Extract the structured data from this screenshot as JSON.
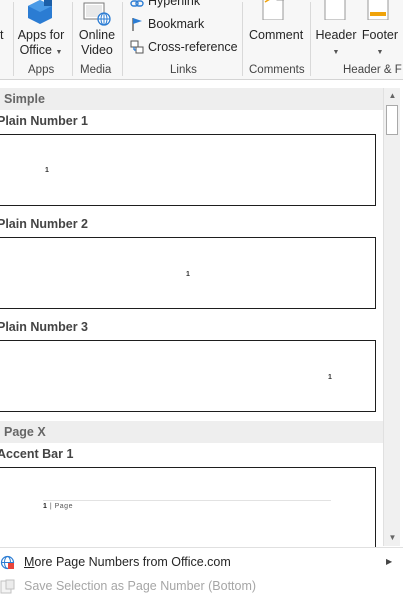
{
  "ribbon": {
    "partial_left_label": "t",
    "apps_for_office": {
      "line1": "Apps for",
      "line2": "Office"
    },
    "online_video": {
      "line1": "Online",
      "line2": "Video"
    },
    "links": {
      "hyperlink": "Hyperlink",
      "bookmark": "Bookmark",
      "cross_reference": "Cross-reference"
    },
    "comment": "Comment",
    "header": "Header",
    "footer": "Footer",
    "groups": {
      "apps": "Apps",
      "media": "Media",
      "links": "Links",
      "comments": "Comments",
      "header_footer": "Header & F"
    }
  },
  "gallery": {
    "sections": [
      {
        "title": "Simple"
      },
      {
        "title": "Page X"
      }
    ],
    "items": [
      {
        "title": "Plain Number 1",
        "number": "1"
      },
      {
        "title": "Plain Number 2",
        "number": "1"
      },
      {
        "title": "Plain Number 3",
        "number": "1"
      },
      {
        "title": "Accent Bar 1",
        "number": "1",
        "bar_text": "Page"
      }
    ]
  },
  "menu": {
    "more_numbers": {
      "prefix": "M",
      "rest": "ore Page Numbers from Office.com"
    },
    "save_selection": "Save Selection as Page Number (Bottom)"
  },
  "colors": {
    "office_blue": "#2b7cd3",
    "accent_orange": "#f0a30a",
    "disabled_text": "#a6a6a6"
  }
}
